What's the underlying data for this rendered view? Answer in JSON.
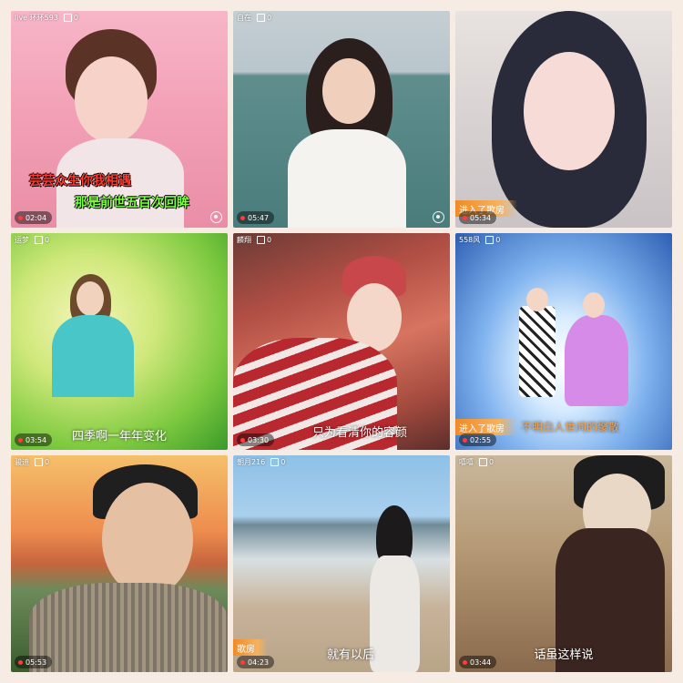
{
  "tiles": [
    {
      "name": "live 环环593",
      "gifts": "0",
      "duration": "02:04",
      "lyric_line1": "芸芸众生你我相遇",
      "lyric_line2": "那是前世五百次回眸",
      "colors": {
        "lyric1": "#ff3b30",
        "lyric2": "#7cff3b"
      }
    },
    {
      "name": "自在",
      "gifts": "0",
      "duration": "05:47"
    },
    {
      "name": "",
      "gifts": "",
      "duration": "05:34",
      "banner": "进入了歌房"
    },
    {
      "name": "运梦",
      "gifts": "0",
      "duration": "03:54",
      "caption": "四季啊一年年变化"
    },
    {
      "name": "麟翔",
      "gifts": "0",
      "duration": "03:30",
      "caption": "只为看清你的容颜"
    },
    {
      "name": "558风",
      "gifts": "0",
      "duration": "02:55",
      "banner": "进入了歌房",
      "caption": "不明白人世间的聚散"
    },
    {
      "name": "骏迪",
      "gifts": "0",
      "duration": "05:53"
    },
    {
      "name": "朝月216",
      "gifts": "0",
      "duration": "04:23",
      "banner": "歌房",
      "caption": "就有以后"
    },
    {
      "name": "嘻嘻",
      "gifts": "0",
      "duration": "03:44",
      "caption": "话虽这样说"
    }
  ],
  "icons": {
    "gift": "gift-icon",
    "location": "location-icon",
    "record": "record-dot-icon"
  }
}
